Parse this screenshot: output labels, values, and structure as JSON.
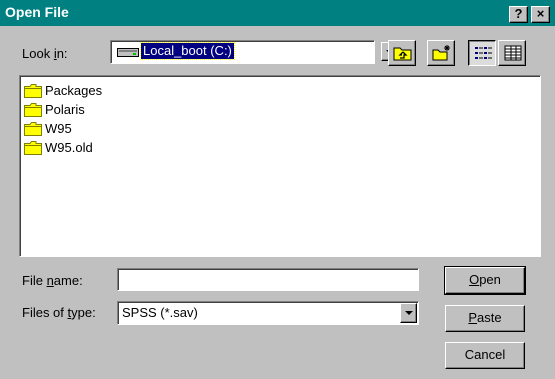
{
  "window": {
    "title": "Open File",
    "help_label": "?",
    "close_label": "×"
  },
  "look_in": {
    "label_pre": "Look ",
    "label_key": "i",
    "label_post": "n:",
    "value": "Local_boot (C:)",
    "icon": "hard-drive-icon"
  },
  "toolbar": {
    "up_icon": "up-one-level-icon",
    "new_folder_icon": "new-folder-icon",
    "list_icon": "list-view-icon",
    "details_icon": "details-view-icon"
  },
  "files": [
    {
      "name": "Packages",
      "icon": "folder-icon"
    },
    {
      "name": "Polaris",
      "icon": "folder-icon"
    },
    {
      "name": "W95",
      "icon": "folder-icon"
    },
    {
      "name": "W95.old",
      "icon": "folder-icon"
    }
  ],
  "file_name": {
    "label_pre": "File ",
    "label_key": "n",
    "label_post": "ame:",
    "value": ""
  },
  "file_type": {
    "label_pre": "Files of ",
    "label_key": "t",
    "label_post": "ype:",
    "value": "SPSS (*.sav)"
  },
  "buttons": {
    "open_key": "O",
    "open_rest": "pen",
    "paste_key": "P",
    "paste_rest": "aste",
    "cancel": "Cancel"
  },
  "colors": {
    "titlebar": "#008080",
    "face": "#c0c0c0",
    "selection": "#000080",
    "folder": "#ffff00"
  }
}
